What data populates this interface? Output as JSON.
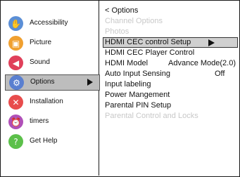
{
  "sidebar": {
    "items": [
      {
        "label": "Accessibility",
        "icon": "hand-icon",
        "glyph": "✋",
        "color": "#5b8fd6"
      },
      {
        "label": "Picture",
        "icon": "picture-icon",
        "glyph": "▣",
        "color": "#f0a030"
      },
      {
        "label": "Sound",
        "icon": "speaker-icon",
        "glyph": "◀",
        "color": "#e0405a"
      },
      {
        "label": "Options",
        "icon": "gear-icon",
        "glyph": "⚙",
        "color": "#5a7fd0",
        "selected": true
      },
      {
        "label": "Installation",
        "icon": "tools-icon",
        "glyph": "✕",
        "color": "#e84c4c"
      },
      {
        "label": "timers",
        "icon": "alarm-clock-icon",
        "glyph": "⏰",
        "color": "#b050b8"
      },
      {
        "label": "Get Help",
        "icon": "help-icon",
        "glyph": "?",
        "color": "#5cc04a"
      }
    ]
  },
  "submenu": {
    "title": "< Options",
    "rows": [
      {
        "label": "Channel Options",
        "disabled": true
      },
      {
        "label": "Photos",
        "disabled": true
      },
      {
        "label": "HDMI CEC control Setup",
        "selected": true
      },
      {
        "label": "HDMI CEC Player Control"
      },
      {
        "label": "HDMI Model",
        "value": "Advance Mode(2.0)"
      },
      {
        "label": "Auto Input Sensing",
        "value": "Off"
      },
      {
        "label": "Input labeling"
      },
      {
        "label": "Power Mangement"
      },
      {
        "label": "Parental PIN Setup"
      },
      {
        "label": "Parental Control and Locks",
        "disabled": true
      }
    ]
  }
}
